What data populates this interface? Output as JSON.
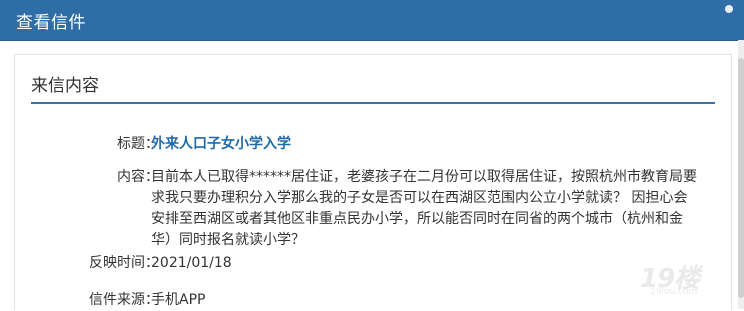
{
  "dialog": {
    "title": "查看信件"
  },
  "section": {
    "title": "来信内容"
  },
  "fields": {
    "subject": {
      "label": "标题：",
      "value": "外来人口子女小学入学"
    },
    "content": {
      "label": "内容：",
      "value": "目前本人已取得******居住证，老婆孩子在二月份可以取得居住证，按照杭州市教育局要求我只要办理积分入学那么我的子女是否可以在西湖区范围内公立小学就读？ 因担心会安排至西湖区或者其他区非重点民办小学，所以能否同时在同省的两个城市（杭州和金华）同时报名就读小学？"
    },
    "date": {
      "label": "反映时间：",
      "value": "2021/01/18"
    },
    "source": {
      "label": "信件来源：",
      "value": "手机APP"
    }
  },
  "watermark": {
    "mark": "19楼",
    "sub": "19lou.com"
  },
  "colors": {
    "title_bar": "#2f6da6",
    "accent_rule": "#3a73a9",
    "subject_text": "#1f6aa8"
  },
  "icons": {
    "close": "close-icon"
  }
}
